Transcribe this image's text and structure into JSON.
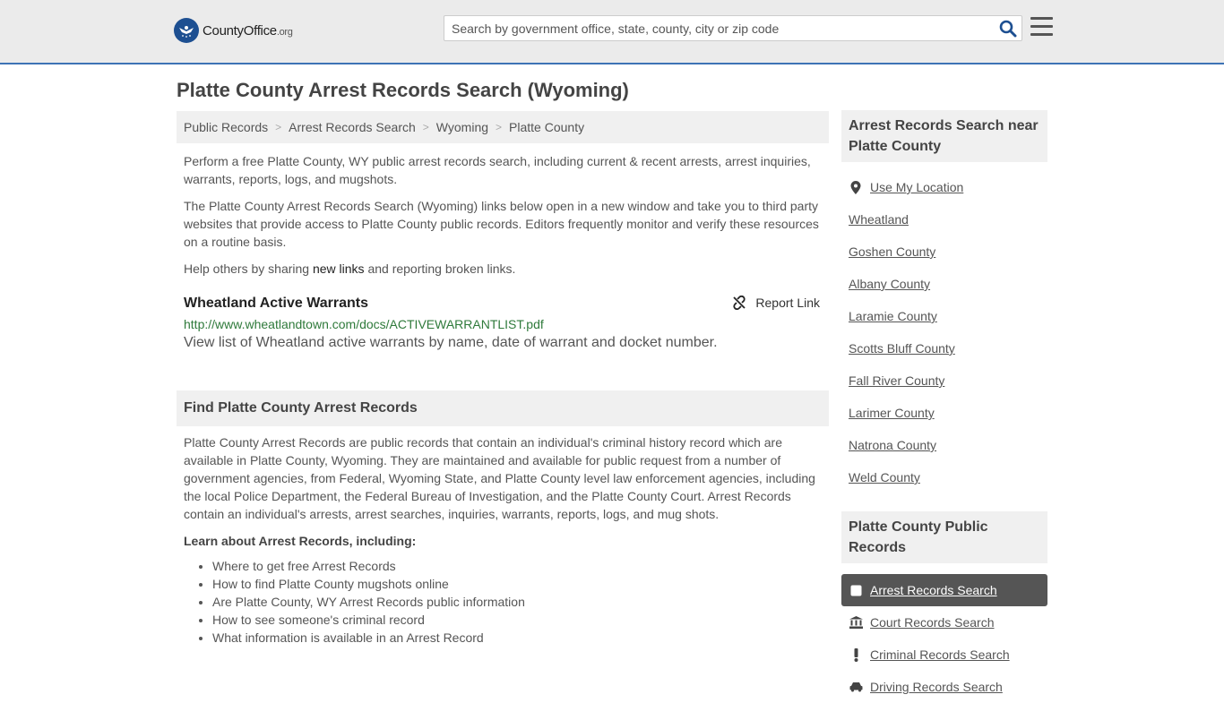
{
  "header": {
    "logo_main": "CountyOffice",
    "logo_org": ".org",
    "search_placeholder": "Search by government office, state, county, city or zip code"
  },
  "page_title": "Platte County Arrest Records Search (Wyoming)",
  "breadcrumb": [
    "Public Records",
    "Arrest Records Search",
    "Wyoming",
    "Platte County"
  ],
  "intro": {
    "p1": "Perform a free Platte County, WY public arrest records search, including current & recent arrests, arrest inquiries, warrants, reports, logs, and mugshots.",
    "p2": "The Platte County Arrest Records Search (Wyoming) links below open in a new window and take you to third party websites that provide access to Platte County public records. Editors frequently monitor and verify these resources on a routine basis.",
    "p3_before": "Help others by sharing ",
    "p3_link": "new links",
    "p3_after": " and reporting broken links."
  },
  "listing": {
    "title": "Wheatland Active Warrants",
    "report_label": "Report Link",
    "url": "http://www.wheatlandtown.com/docs/ACTIVEWARRANTLIST.pdf",
    "description": "View list of Wheatland active warrants by name, date of warrant and docket number."
  },
  "find_section": {
    "heading": "Find Platte County Arrest Records",
    "body": "Platte County Arrest Records are public records that contain an individual's criminal history record which are available in Platte County, Wyoming. They are maintained and available for public request from a number of government agencies, from Federal, Wyoming State, and Platte County level law enforcement agencies, including the local Police Department, the Federal Bureau of Investigation, and the Platte County Court. Arrest Records contain an individual's arrests, arrest searches, inquiries, warrants, reports, logs, and mug shots.",
    "learn_title": "Learn about Arrest Records, including:",
    "learn_items": [
      "Where to get free Arrest Records",
      "How to find Platte County mugshots online",
      "Are Platte County, WY Arrest Records public information",
      "How to see someone's criminal record",
      "What information is available in an Arrest Record"
    ]
  },
  "sidebar": {
    "near_heading": "Arrest Records Search near Platte County",
    "near_items": [
      "Use My Location",
      "Wheatland",
      "Goshen County",
      "Albany County",
      "Laramie County",
      "Scotts Bluff County",
      "Fall River County",
      "Larimer County",
      "Natrona County",
      "Weld County"
    ],
    "records_heading": "Platte County Public Records",
    "records_items": [
      "Arrest Records Search",
      "Court Records Search",
      "Criminal Records Search",
      "Driving Records Search"
    ]
  },
  "colors": {
    "accent_blue": "#3d73b5",
    "url_green": "#2f7a3b",
    "active_bg": "#555555"
  }
}
